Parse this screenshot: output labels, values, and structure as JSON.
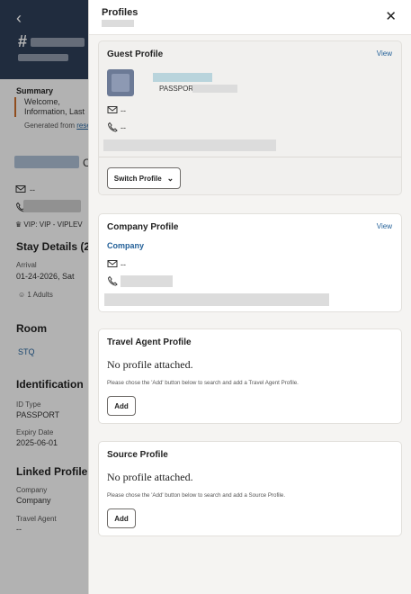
{
  "background": {
    "hash": "#",
    "summary_label": "Summary",
    "summary_line1": "Welcome,",
    "summary_line2": "Information, Last",
    "generated_prefix": "Generated from",
    "generated_link": "rese",
    "email_value": "--",
    "vip_text": "VIP: VIP - VIPLEV",
    "stay_details": "Stay Details (2",
    "arrival_label": "Arrival",
    "arrival_value": "01-24-2026, Sat",
    "adults": "1 Adults",
    "room_title": "Room",
    "room_value": "STQ",
    "identification_title": "Identification",
    "id_type_label": "ID Type",
    "id_type_value": "PASSPORT",
    "expiry_label": "Expiry Date",
    "expiry_value": "2025-06-01",
    "linked_title": "Linked Profile",
    "company_label": "Company",
    "company_value": "Company",
    "travel_agent_label": "Travel Agent",
    "travel_agent_value": "--"
  },
  "drawer": {
    "title": "Profiles",
    "guest": {
      "title": "Guest Profile",
      "view": "View",
      "doc_type": "PASSPORT",
      "email": "--",
      "phone": "--",
      "switch_label": "Switch Profile"
    },
    "company": {
      "title": "Company Profile",
      "view": "View",
      "name": "Company",
      "email": "--"
    },
    "travel_agent": {
      "title": "Travel Agent Profile",
      "empty": "No profile attached.",
      "hint": "Please chose the 'Add' button below to search and add a Travel Agent Profile.",
      "add_label": "Add"
    },
    "source": {
      "title": "Source Profile",
      "empty": "No profile attached.",
      "hint": "Please chose the 'Add' button below to search and add a Source Profile.",
      "add_label": "Add"
    }
  }
}
